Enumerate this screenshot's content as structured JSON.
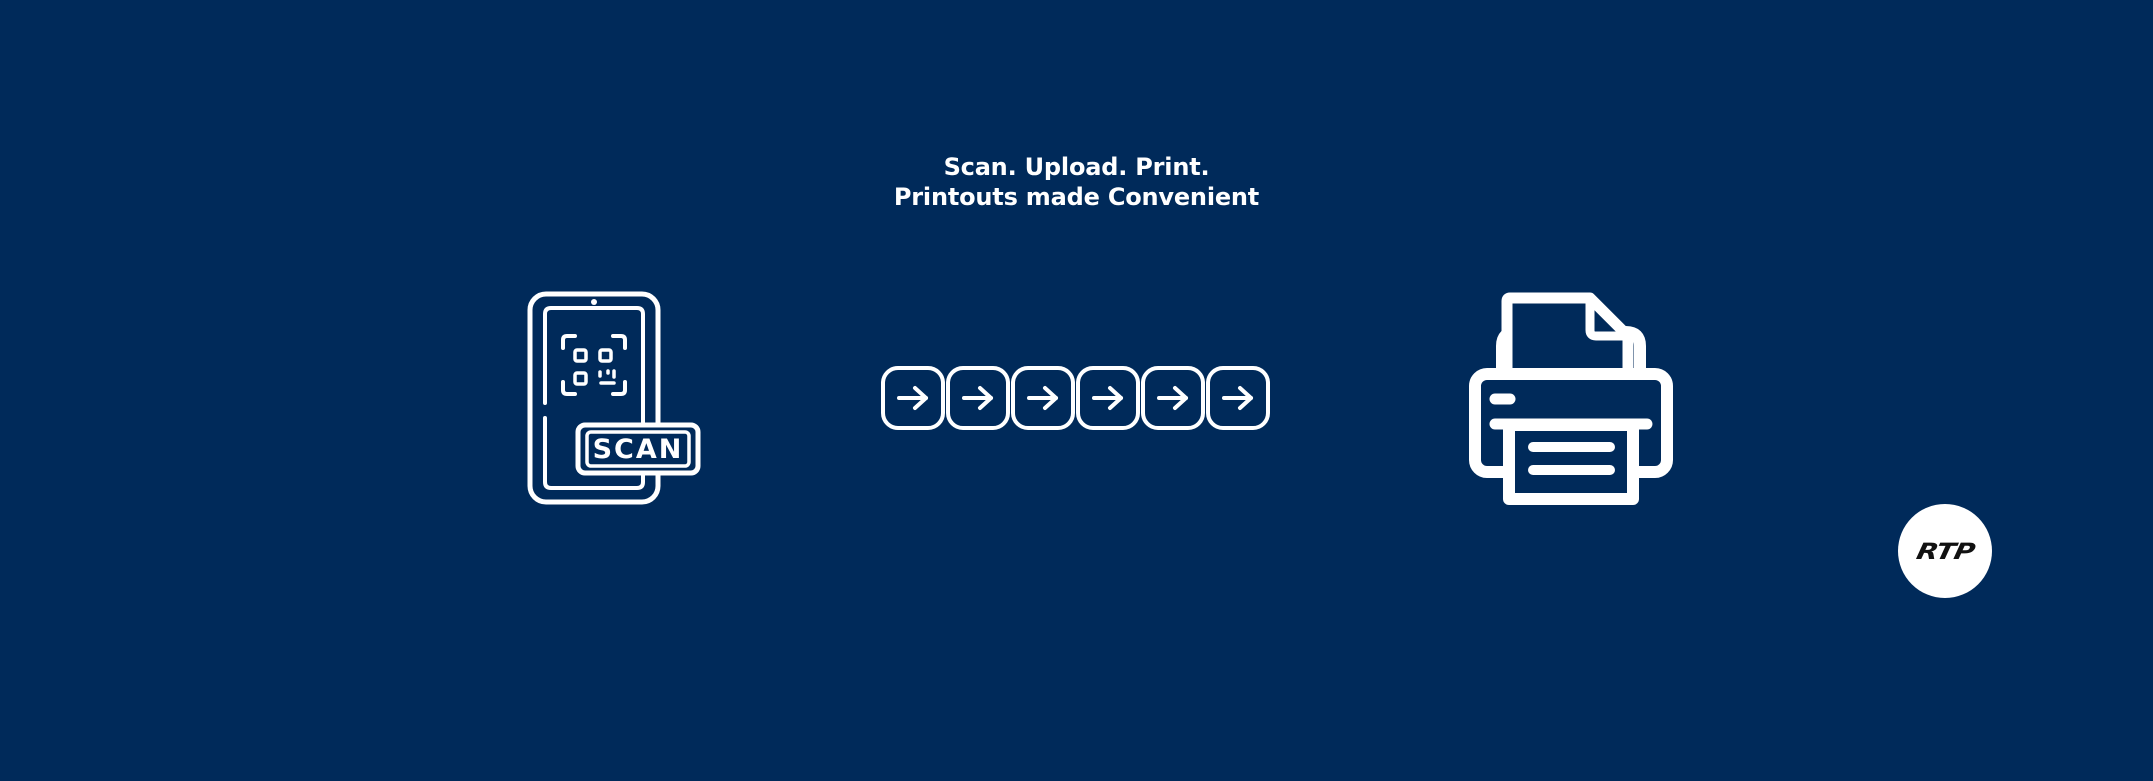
{
  "colors": {
    "background": "#002a5a",
    "foreground": "#ffffff",
    "logo_text": "#111111"
  },
  "headline": {
    "line1": "Scan. Upload. Print.",
    "line2": "Printouts made Convenient"
  },
  "scan_icon": {
    "name": "phone-qr-scan-icon",
    "label": "SCAN"
  },
  "arrows": {
    "icon": "arrow-right-icon",
    "count": 6
  },
  "printer_icon": {
    "name": "printer-icon"
  },
  "logo": {
    "text": "RTP"
  }
}
